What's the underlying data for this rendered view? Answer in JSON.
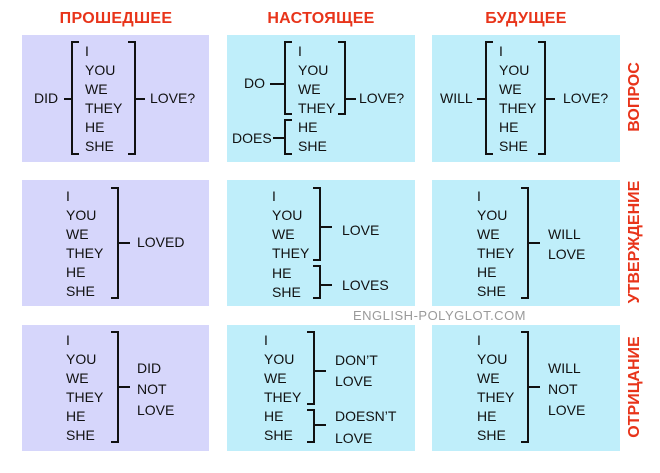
{
  "columns": [
    "ПРОШЕДШЕЕ",
    "НАСТОЯЩЕЕ",
    "БУДУЩЕЕ"
  ],
  "rows": [
    "ВОПРОС",
    "УТВЕРЖДЕНИЕ",
    "ОТРИЦАНИЕ"
  ],
  "pronouns": [
    "I",
    "YOU",
    "WE",
    "THEY",
    "HE",
    "SHE"
  ],
  "pronouns_i_you_we_they": [
    "I",
    "YOU",
    "WE",
    "THEY"
  ],
  "pronouns_he_she": [
    "HE",
    "SHE"
  ],
  "question": {
    "past": {
      "aux": "DID",
      "verb": "LOVE?"
    },
    "present": {
      "aux_plural": "DO",
      "aux_singular": "DOES",
      "verb": "LOVE?"
    },
    "future": {
      "aux": "WILL",
      "verb": "LOVE?"
    }
  },
  "statement": {
    "past": {
      "verb": "LOVED"
    },
    "present": {
      "verb_plural": "LOVE",
      "verb_singular": "LOVES"
    },
    "future": {
      "line1": "WILL",
      "line2": "LOVE"
    }
  },
  "negation": {
    "past": {
      "line1": "DID",
      "line2": "NOT",
      "line3": "LOVE"
    },
    "present": {
      "plural_line1": "DON’T",
      "plural_line2": "LOVE",
      "singular_line1": "DOESN’T",
      "singular_line2": "LOVE"
    },
    "future": {
      "line1": "WILL",
      "line2": "NOT",
      "line3": "LOVE"
    }
  },
  "watermark": "ENGLISH-POLYGLOT.COM",
  "colors": {
    "header": "#e8341a",
    "past_box": "#d6d6fb",
    "box": "#bfeefa"
  }
}
